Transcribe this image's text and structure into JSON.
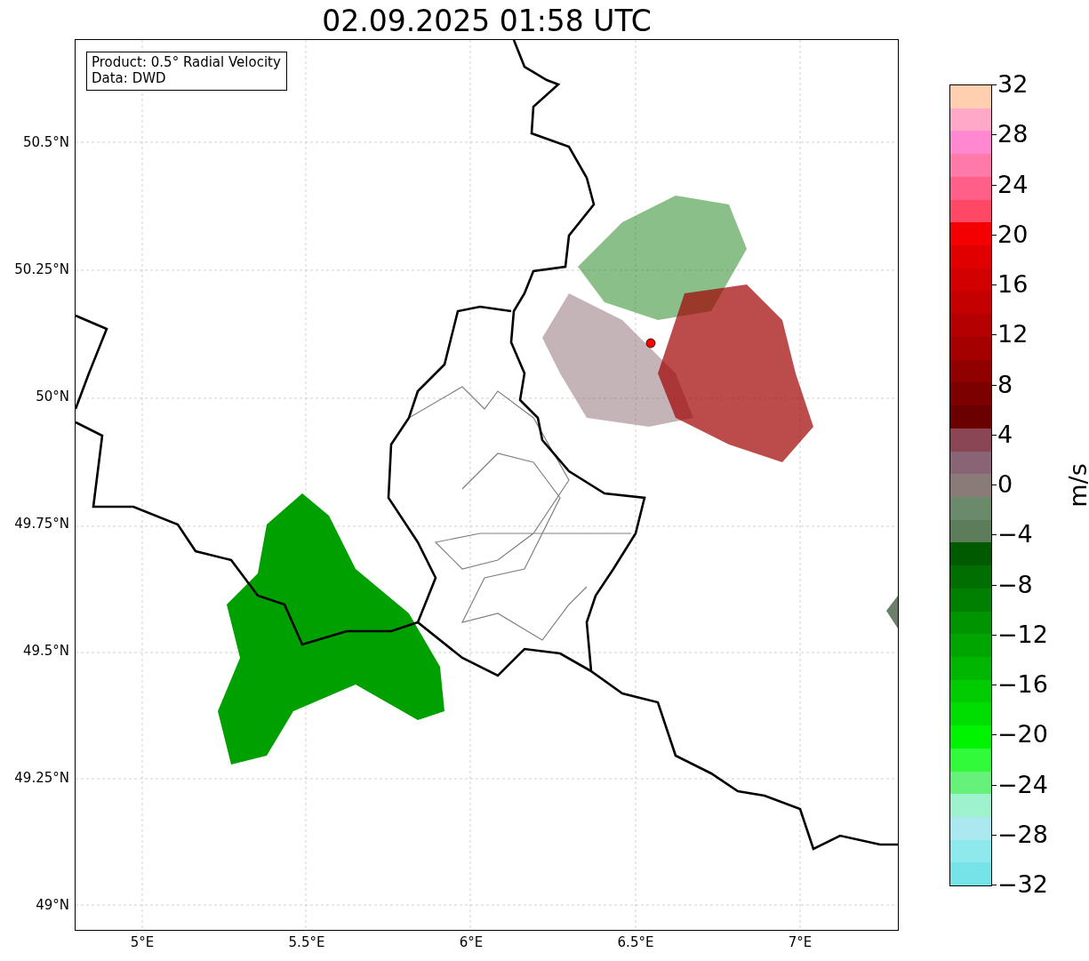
{
  "title": "02.09.2025 01:58 UTC",
  "info_box": [
    "Product: 0.5° Radial Velocity",
    "Data: DWD"
  ],
  "map": {
    "y_labels": [
      "50.5°N",
      "50.25°N",
      "50°N",
      "49.75°N",
      "49.5°N",
      "49.25°N",
      "49°N"
    ],
    "x_labels": [
      "5°E",
      "5.5°E",
      "6°E",
      "6.5°E",
      "7°E"
    ]
  },
  "colorbar": {
    "label": "m/s",
    "ticks": [
      "32",
      "28",
      "24",
      "20",
      "16",
      "12",
      "8",
      "4",
      "0",
      "−4",
      "−8",
      "−12",
      "−16",
      "−20",
      "−24",
      "−28",
      "−32"
    ],
    "segments": [
      {
        "color": "#ffcfb0"
      },
      {
        "color": "#ffa8c8"
      },
      {
        "color": "#ff88d0"
      },
      {
        "color": "#ff7aa8"
      },
      {
        "color": "#ff6088"
      },
      {
        "color": "#ff4866"
      },
      {
        "color": "#f50000"
      },
      {
        "color": "#e00000"
      },
      {
        "color": "#d20000"
      },
      {
        "color": "#c40000"
      },
      {
        "color": "#b40000"
      },
      {
        "color": "#a40000"
      },
      {
        "color": "#900000"
      },
      {
        "color": "#7c0000"
      },
      {
        "color": "#6a0000"
      },
      {
        "color": "#8a4652"
      },
      {
        "color": "#896474"
      },
      {
        "color": "#8a7b79"
      },
      {
        "color": "#6b8a6b"
      },
      {
        "color": "#5b7d5a"
      },
      {
        "color": "#005a00"
      },
      {
        "color": "#006e00"
      },
      {
        "color": "#008000"
      },
      {
        "color": "#009400"
      },
      {
        "color": "#00a500"
      },
      {
        "color": "#00b600"
      },
      {
        "color": "#00cc00"
      },
      {
        "color": "#00dd00"
      },
      {
        "color": "#00f400"
      },
      {
        "color": "#30fa3a"
      },
      {
        "color": "#66f27a"
      },
      {
        "color": "#9ef2cc"
      },
      {
        "color": "#ace8ef"
      },
      {
        "color": "#8ee9ec"
      },
      {
        "color": "#76e3e8"
      }
    ]
  }
}
